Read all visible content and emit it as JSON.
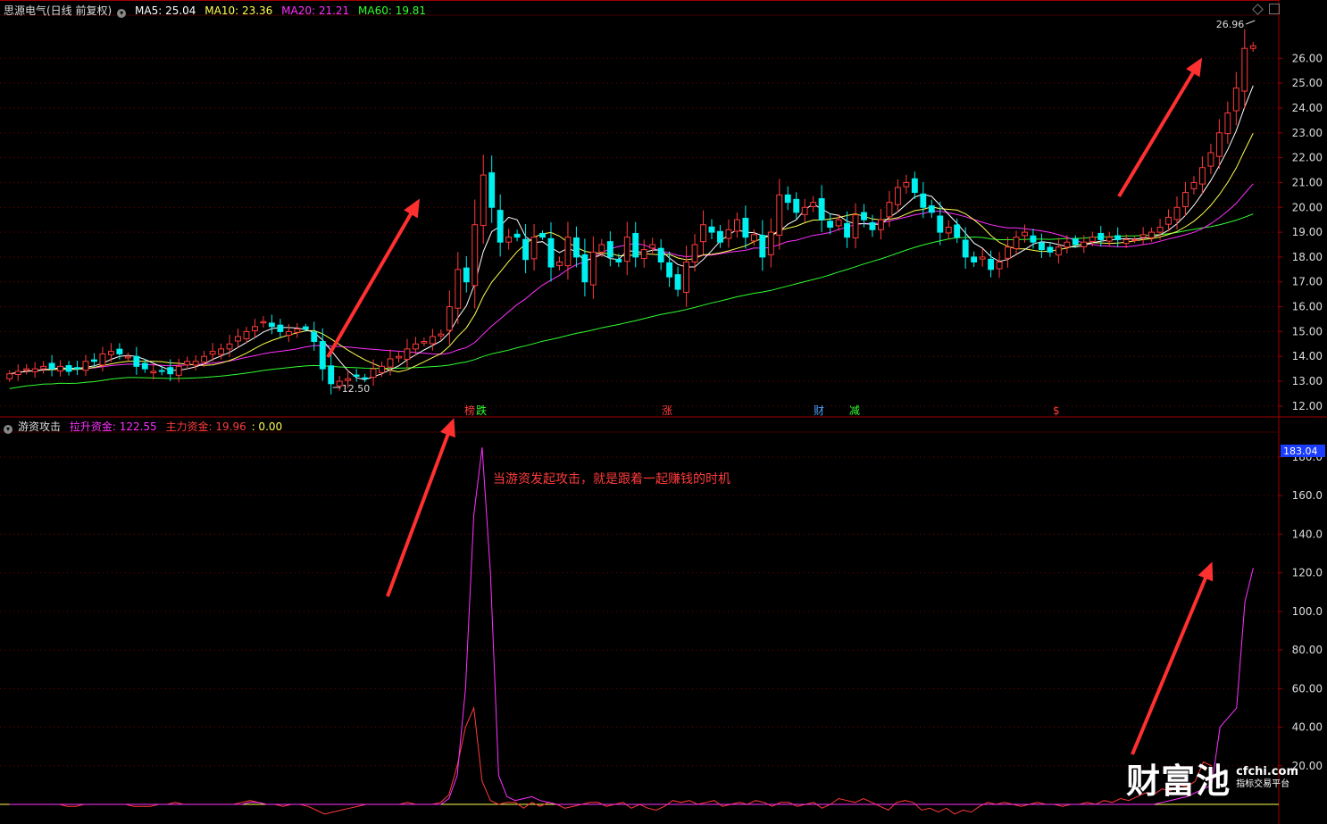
{
  "header": {
    "stock_name": "思源电气(日线 前复权)",
    "ma5": "MA5: 25.04",
    "ma10": "MA10: 23.36",
    "ma20": "MA20: 21.21",
    "ma60": "MA60: 19.81"
  },
  "indicator_header": {
    "name": "游资攻击",
    "lasheng": "拉升资金: 122.55",
    "zhuli": "主力资金: 19.96",
    "zero": ": 0.00"
  },
  "annotation": "当游资发起攻击，就是跟着一起赚钱的时机",
  "logo": {
    "main": "财富池",
    "site": "cfchi.com",
    "tagline": "指标交易平台"
  },
  "colors": {
    "up": "#ff3b3b",
    "down": "#00f0f0",
    "ma5": "#ffffff",
    "ma10": "#ffff50",
    "ma20": "#ff30ff",
    "ma60": "#30ff30",
    "axis": "#a00000",
    "grid": "#7a0000"
  },
  "chart_data": [
    {
      "type": "candlestick",
      "title": "思源电气(日线 前复权)",
      "ylim": [
        11.6,
        27.7
      ],
      "y_ticks": [
        12.0,
        13.0,
        14.0,
        15.0,
        16.0,
        17.0,
        18.0,
        19.0,
        20.0,
        21.0,
        22.0,
        23.0,
        24.0,
        25.0,
        26.0
      ],
      "y_tick_labels": [
        "12.00",
        "13.00",
        "14.00",
        "15.00",
        "16.00",
        "17.00",
        "18.00",
        "19.00",
        "20.00",
        "21.00",
        "22.00",
        "23.00",
        "24.00",
        "25.00",
        "26.00"
      ],
      "high_label": "26.96",
      "low_label": "12.50",
      "event_markers": [
        "榜",
        "跌",
        "涨",
        "财",
        "减",
        "$"
      ],
      "closes": [
        13.3,
        13.4,
        13.5,
        13.5,
        13.6,
        13.5,
        13.6,
        13.4,
        13.5,
        13.8,
        13.8,
        14.1,
        14.2,
        14.1,
        14.0,
        13.6,
        13.5,
        13.4,
        13.4,
        13.3,
        13.6,
        13.8,
        13.8,
        14.0,
        14.2,
        14.3,
        14.5,
        14.8,
        15.0,
        15.2,
        15.4,
        15.2,
        15.0,
        15.0,
        15.1,
        15.1,
        14.6,
        13.5,
        12.9,
        13.0,
        13.1,
        13.2,
        13.1,
        13.5,
        13.6,
        13.9,
        14.0,
        14.3,
        14.5,
        14.6,
        14.8,
        14.9,
        16.0,
        17.5,
        17.0,
        19.3,
        21.3,
        20.0,
        18.6,
        18.8,
        18.8,
        17.9,
        18.8,
        18.8,
        17.6,
        17.8,
        18.8,
        18.0,
        17.0,
        18.2,
        18.5,
        18.0,
        17.8,
        18.8,
        18.0,
        18.3,
        18.5,
        17.8,
        17.2,
        16.7,
        17.8,
        18.5,
        19.3,
        19.0,
        18.6,
        19.1,
        19.5,
        18.8,
        18.9,
        18.0,
        19.0,
        20.5,
        20.2,
        19.8,
        20.0,
        20.2,
        19.5,
        19.2,
        19.5,
        18.8,
        19.7,
        19.5,
        19.1,
        19.5,
        20.2,
        20.8,
        21.0,
        20.6,
        20.0,
        19.8,
        19.0,
        19.2,
        18.8,
        18.0,
        17.8,
        18.0,
        17.5,
        17.8,
        18.4,
        18.8,
        19.0,
        18.6,
        18.3,
        18.2,
        18.4,
        18.6,
        18.5,
        18.6,
        18.8,
        18.7,
        18.8,
        18.7,
        18.7,
        18.7,
        18.9,
        19.0,
        19.2,
        19.6,
        20.0,
        20.6,
        21.0,
        21.6,
        22.2,
        23.0,
        23.8,
        24.8,
        26.4,
        26.5
      ]
    },
    {
      "type": "line",
      "title": "游资攻击",
      "ylim": [
        0,
        192
      ],
      "y_ticks": [
        20.0,
        40.0,
        60.0,
        80.0,
        100.0,
        120.0,
        140.0,
        160.0,
        180.0
      ],
      "y_tick_labels": [
        "20.00",
        "40.00",
        "60.00",
        "80.00",
        "100.0",
        "120.0",
        "140.0",
        "160.0",
        "180.0"
      ],
      "current_value_label": "183.04",
      "series": [
        {
          "name": "拉升资金",
          "values": [
            0,
            0,
            0,
            0,
            0,
            0,
            0,
            0,
            0,
            0,
            0,
            0,
            0,
            0,
            0,
            0,
            0,
            0,
            0,
            0,
            0,
            0,
            0,
            0,
            0,
            0,
            0,
            0,
            0,
            1,
            1,
            0,
            0,
            0,
            0,
            0,
            0,
            0,
            0,
            0,
            0,
            0,
            0,
            0,
            0,
            0,
            0,
            0,
            0,
            0,
            0,
            0,
            0,
            3,
            15,
            60,
            150,
            185,
            120,
            15,
            4,
            2,
            3,
            4,
            2,
            1,
            0,
            0,
            0,
            0,
            0,
            0,
            0,
            0,
            0,
            0,
            0,
            0,
            0,
            0,
            0,
            0,
            0,
            0,
            0,
            0,
            0,
            0,
            0,
            0,
            0,
            0,
            0,
            0,
            0,
            0,
            0,
            0,
            0,
            0,
            0,
            0,
            0,
            0,
            0,
            0,
            0,
            0,
            0,
            0,
            0,
            0,
            0,
            0,
            0,
            0,
            0,
            0,
            0,
            0,
            0,
            0,
            0,
            0,
            0,
            0,
            0,
            0,
            0,
            0,
            0,
            0,
            0,
            0,
            0,
            0,
            0,
            0,
            0,
            1,
            2,
            3,
            4,
            6,
            8,
            10,
            40,
            45,
            50,
            105,
            122.55
          ]
        },
        {
          "name": "主力资金",
          "values": [
            0,
            0,
            0,
            0,
            0,
            0,
            0,
            -1,
            -1,
            0,
            0,
            0,
            0,
            0,
            0,
            -1,
            -1,
            -1,
            0,
            0,
            1,
            0,
            0,
            0,
            0,
            0,
            0,
            0,
            1,
            2,
            1,
            0,
            0,
            -1,
            0,
            0,
            -1,
            -3,
            -5,
            -4,
            -3,
            -2,
            -1,
            0,
            0,
            0,
            0,
            0,
            1,
            0,
            0,
            0,
            1,
            5,
            20,
            40,
            50,
            12,
            2,
            0,
            1,
            1,
            -2,
            1,
            -1,
            1,
            0,
            -2,
            -1,
            0,
            1,
            1,
            -1,
            0,
            1,
            -2,
            0,
            -2,
            -3,
            -1,
            2,
            1,
            2,
            0,
            1,
            2,
            -1,
            0,
            1,
            0,
            2,
            1,
            -1,
            1,
            1,
            -1,
            0,
            1,
            -2,
            0,
            3,
            2,
            1,
            3,
            1,
            -1,
            -3,
            1,
            2,
            1,
            -3,
            -2,
            -4,
            -2,
            -5,
            -3,
            -4,
            -1,
            1,
            0,
            1,
            0,
            -1,
            0,
            1,
            0,
            0,
            -1,
            0,
            0,
            1,
            0,
            2,
            1,
            3,
            2,
            4,
            6,
            5,
            8,
            7,
            10,
            9,
            12,
            22,
            19.96
          ]
        },
        {
          "name": "",
          "values": [
            0
          ]
        }
      ]
    }
  ]
}
